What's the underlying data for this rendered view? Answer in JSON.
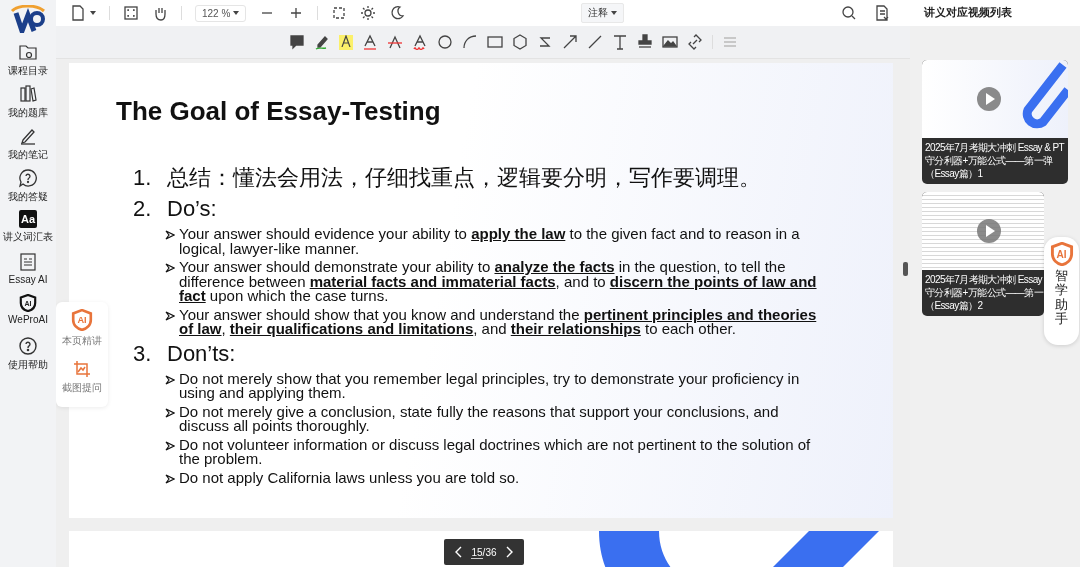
{
  "toolbar": {
    "zoom": "122 %",
    "mode_menu": "注释"
  },
  "sidebar": {
    "items": [
      {
        "label": "课程目录"
      },
      {
        "label": "我的题库"
      },
      {
        "label": "我的笔记"
      },
      {
        "label": "我的答疑"
      },
      {
        "label": "讲义词汇表",
        "icon_text": "Aa"
      },
      {
        "label": "Essay AI"
      },
      {
        "label": "WeProAI",
        "icon_text": "AI"
      },
      {
        "label": "使用帮助"
      }
    ]
  },
  "page_tools": [
    {
      "label": "本页精讲",
      "icon_text": "AI"
    },
    {
      "label": "截图提问"
    }
  ],
  "slide": {
    "title": "The Goal of Essay-Testing",
    "sections": [
      {
        "number": "1.",
        "heading": "总结：懂法会用法，仔细找重点，逻辑要分明，写作要调理。"
      },
      {
        "number": "2.",
        "heading": "Do’s:",
        "bullets": [
          "Your answer should evidence your ability to **apply the law** to the given fact and to reason in a logical, lawyer-like manner.",
          "Your answer should demonstrate your ability to **analyze the facts** in the question, to tell the difference between **material facts and immaterial facts**, and to **discern the points of law and fact** upon which the case turns.",
          "Your answer should show that you know and understand the **pertinent principles and theories of law**, **their qualifications and limitations**, and **their relationships** to each other."
        ]
      },
      {
        "number": "3.",
        "heading": "Don’ts:",
        "bullets": [
          "Do not merely show that you remember legal principles, try to demonstrate your proficiency in using and applying them.",
          "Do not merely give a conclusion, state fully the reasons that support your conclusions, and discuss all points thoroughly.",
          "Do not volunteer information or discuss legal doctrines which are not pertinent to the solution of the problem.",
          "Do not apply California laws unless you are told so."
        ]
      }
    ]
  },
  "page_nav": {
    "current": "15",
    "total": "/36"
  },
  "video_panel": {
    "title": "讲义对应视频列表",
    "videos": [
      {
        "title_lines": [
          "2025年7月考期大冲刺 Essay & PT",
          "守分利器+万能公式——第一弹",
          "（Essay篇）1"
        ]
      },
      {
        "title_lines": [
          "2025年7月考期大冲刺 Essay",
          "守分利器+万能公式——第一",
          "（Essay篇）2"
        ]
      }
    ]
  },
  "assistant": {
    "label": "智学助手",
    "icon_text": "AI"
  }
}
